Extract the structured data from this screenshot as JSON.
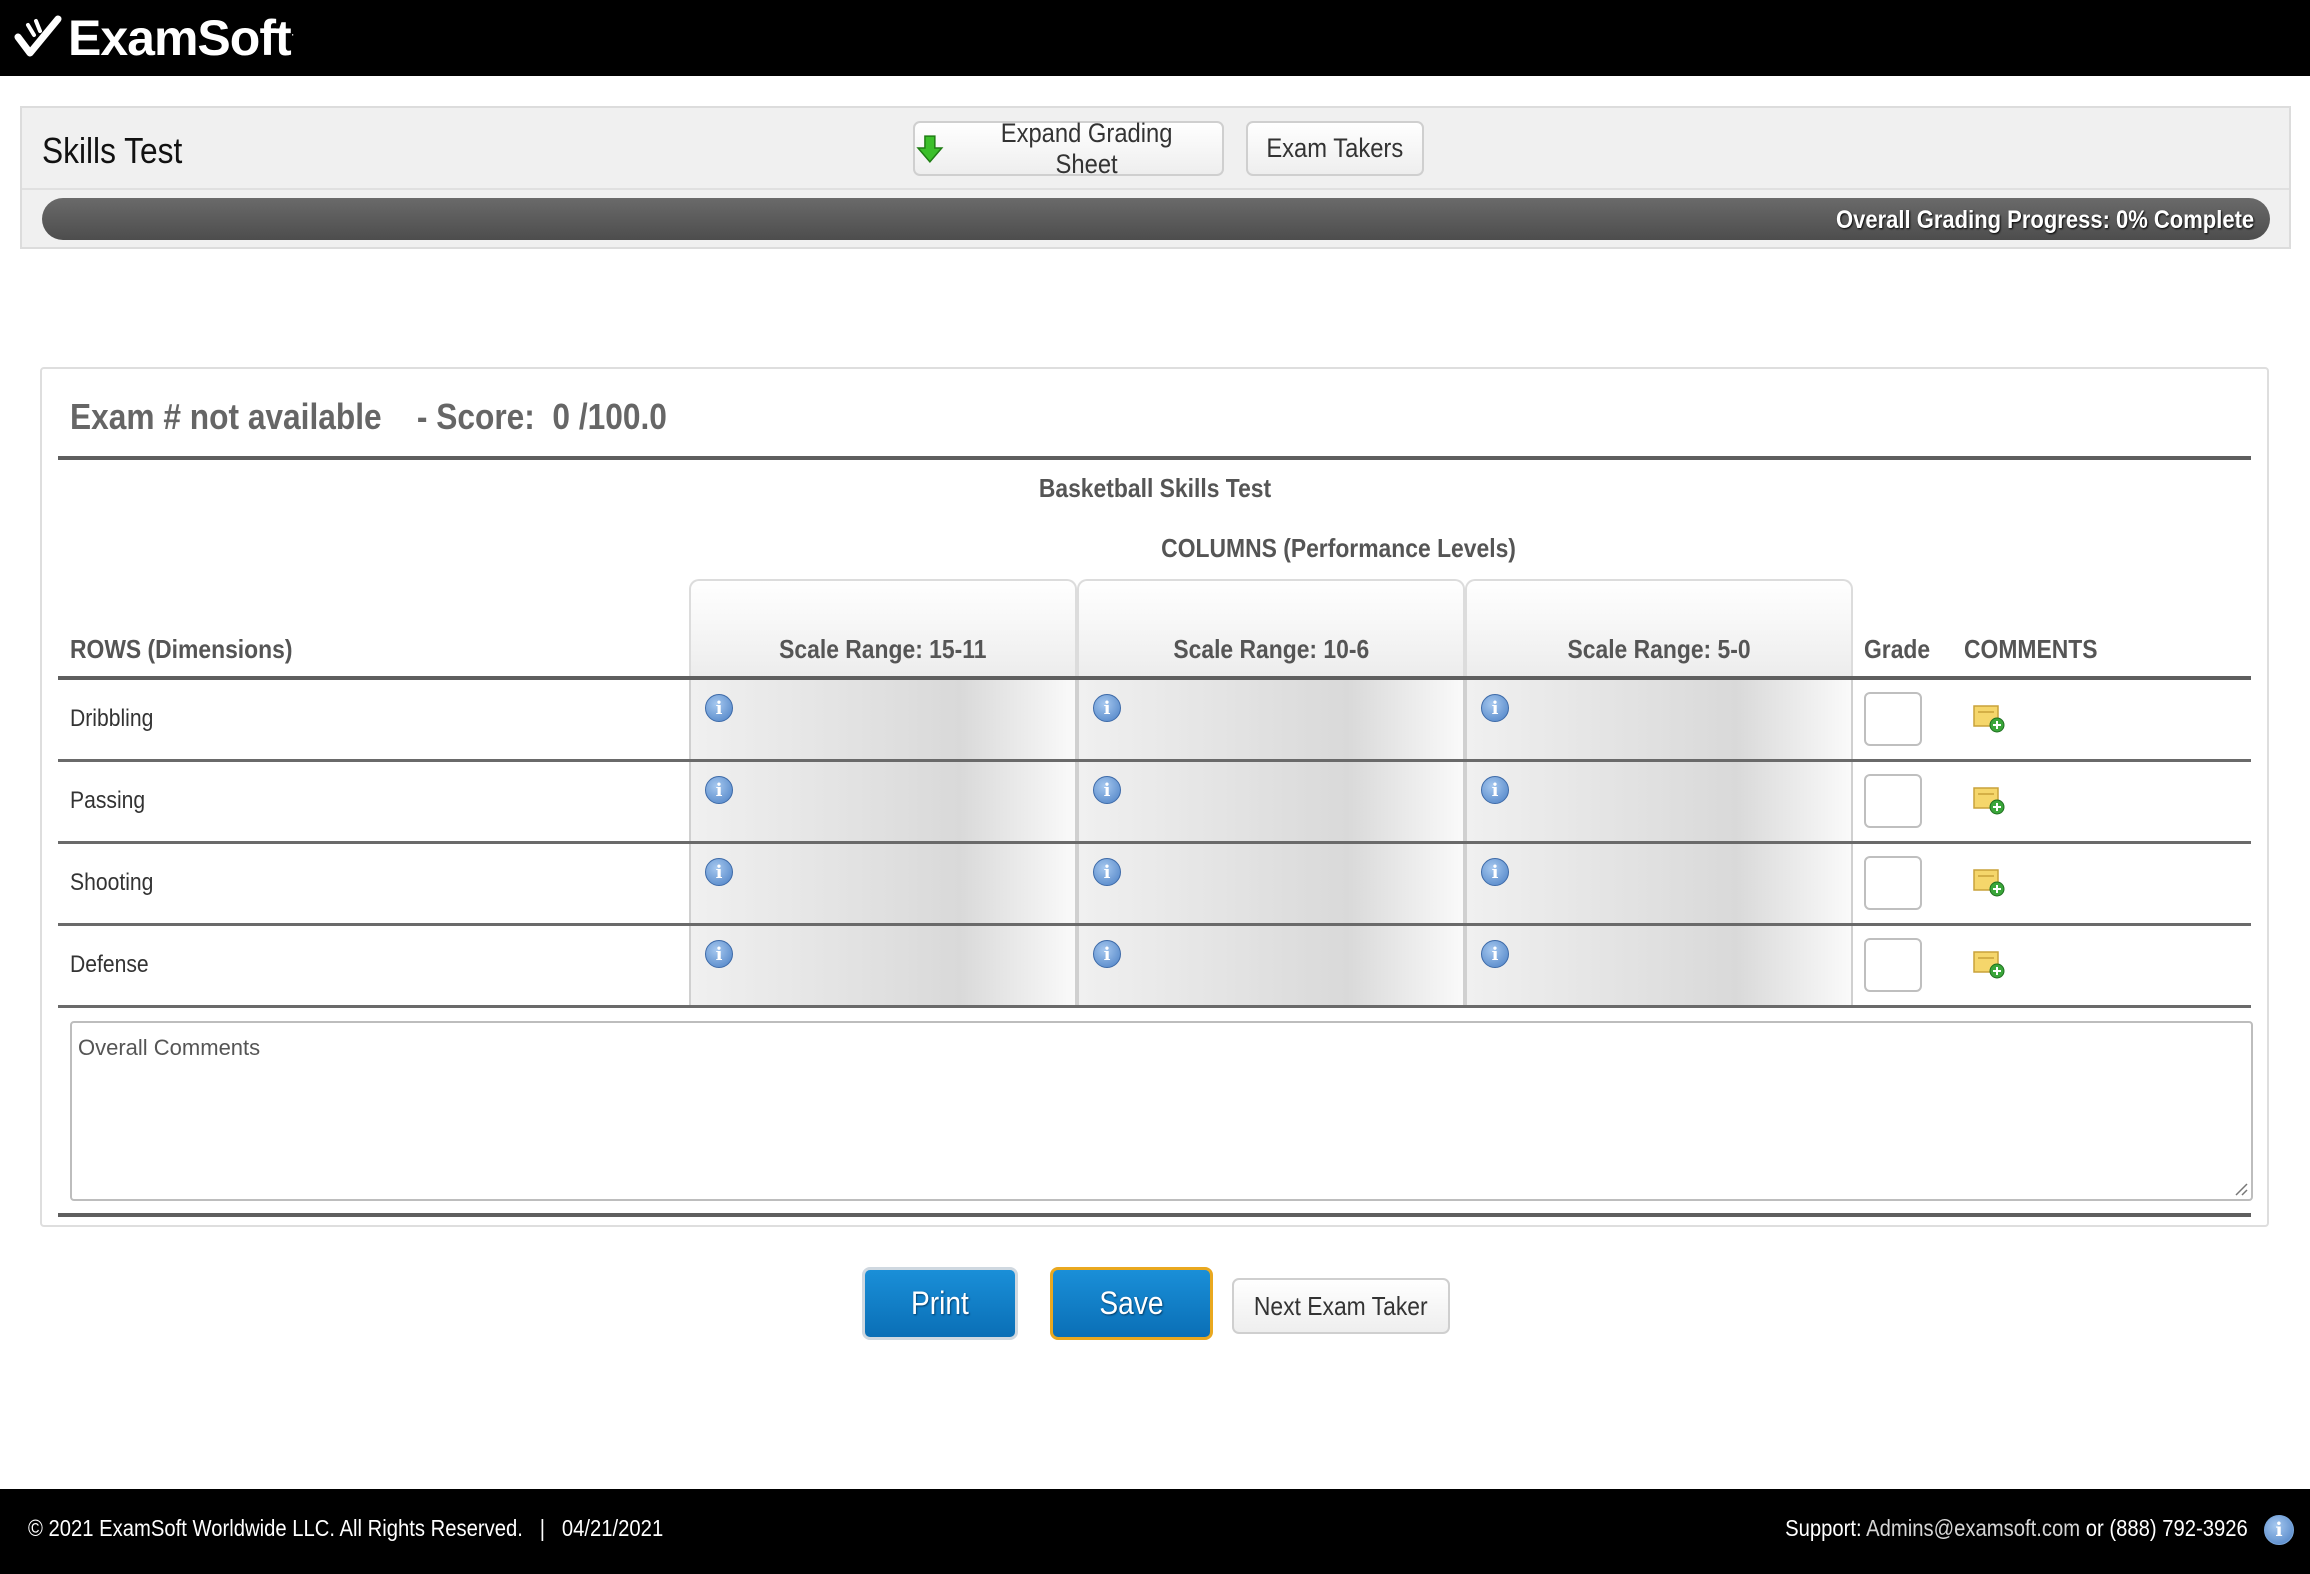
{
  "brand": {
    "name": "ExamSoft",
    "trademark": "·"
  },
  "header": {
    "title": "Skills Test",
    "expand_button": "Expand Grading Sheet",
    "takers_button": "Exam Takers",
    "progress_text": "Overall Grading Progress: 0% Complete",
    "progress_percent": 0
  },
  "exam": {
    "title": "Exam # not available    - Score:  0 /100.0",
    "test_name": "Basketball Skills Test",
    "columns_title": "COLUMNS (Performance Levels)",
    "rows_header": "ROWS (Dimensions)",
    "grade_header": "Grade",
    "comments_header": "COMMENTS",
    "scales": [
      "Scale Range: 15-11",
      "Scale Range: 10-6",
      "Scale Range: 5-0"
    ],
    "rows": [
      {
        "label": "Dribbling",
        "grade": ""
      },
      {
        "label": "Passing",
        "grade": ""
      },
      {
        "label": "Shooting",
        "grade": ""
      },
      {
        "label": "Defense",
        "grade": ""
      }
    ],
    "overall_comments_placeholder": "Overall Comments"
  },
  "actions": {
    "print": "Print",
    "save": "Save",
    "next": "Next Exam Taker"
  },
  "footer": {
    "copyright": "© 2021 ExamSoft Worldwide LLC. All Rights Reserved.   |   04/21/2021",
    "support_label": "Support: ",
    "support_email": "Admins@examsoft.com",
    "support_phone": " or (888) 792-3926"
  },
  "colors": {
    "accent_blue": "#0a7cc6",
    "save_border": "#e9a81f",
    "topbar": "#000000",
    "info_icon": "#4a7fc4"
  },
  "icons": [
    "checkmark-logo-icon",
    "download-arrow-icon",
    "info-icon",
    "add-comment-icon",
    "resize-grip-icon"
  ]
}
